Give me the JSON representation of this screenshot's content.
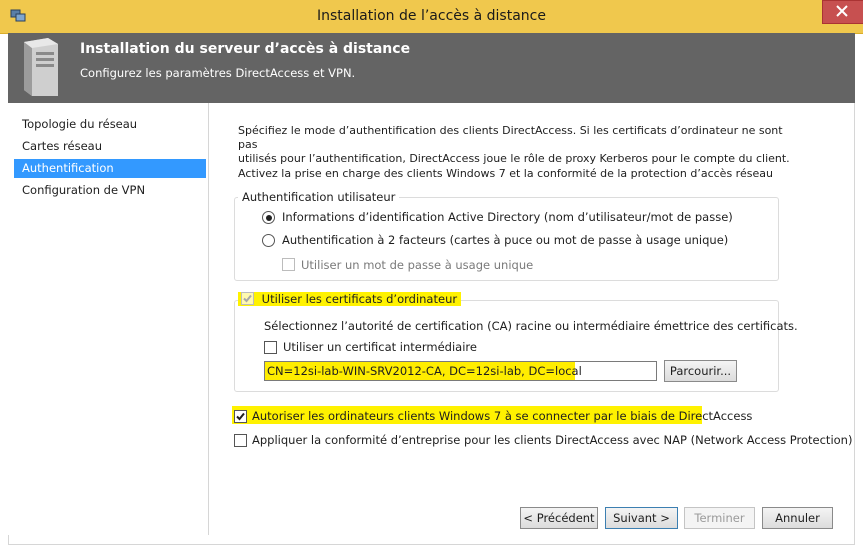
{
  "window": {
    "title": "Installation de l’accès à distance"
  },
  "header": {
    "title": "Installation du serveur d’accès à distance",
    "subtitle": "Configurez les paramètres DirectAccess et VPN."
  },
  "sidebar": {
    "items": [
      {
        "label": "Topologie du réseau",
        "selected": false
      },
      {
        "label": "Cartes réseau",
        "selected": false
      },
      {
        "label": "Authentification",
        "selected": true
      },
      {
        "label": "Configuration de VPN",
        "selected": false
      }
    ]
  },
  "main": {
    "description": [
      "Spécifiez le mode d’authentification des clients DirectAccess. Si les certificats d’ordinateur ne sont pas",
      "utilisés pour l’authentification, DirectAccess joue le rôle de proxy Kerberos pour le compte du client.",
      "Activez la prise en charge des clients Windows 7 et la conformité de la protection d’accès réseau"
    ],
    "user_auth": {
      "legend": "Authentification utilisateur",
      "option_ad": "Informations d’identification Active Directory (nom d’utilisateur/mot de passe)",
      "option_2fa": "Authentification à 2 facteurs (cartes à puce ou mot de passe à usage unique)",
      "otp": "Utiliser un mot de passe à usage unique"
    },
    "certs": {
      "legend": "Utiliser les certificats d’ordinateur",
      "ca_text": "Sélectionnez l’autorité de certification (CA) racine ou intermédiaire émettrice des certificats.",
      "intermediate": "Utiliser un certificat intermédiaire",
      "ca_value": "CN=12si-lab-WIN-SRV2012-CA, DC=12si-lab, DC=local",
      "browse": "Parcourir..."
    },
    "win7": "Autoriser les ordinateurs clients Windows 7 à se connecter par le biais de DirectAccess",
    "nap": "Appliquer la conformité d’entreprise pour les clients DirectAccess avec NAP (Network Access Protection)"
  },
  "buttons": {
    "prev": "< Précédent",
    "next": "Suivant >",
    "finish": "Terminer",
    "cancel": "Annuler"
  },
  "colors": {
    "titlebar": "#f0c84d",
    "header": "#646464",
    "selection": "#3399ff",
    "highlight": "#fff200",
    "close": "#c75050"
  }
}
